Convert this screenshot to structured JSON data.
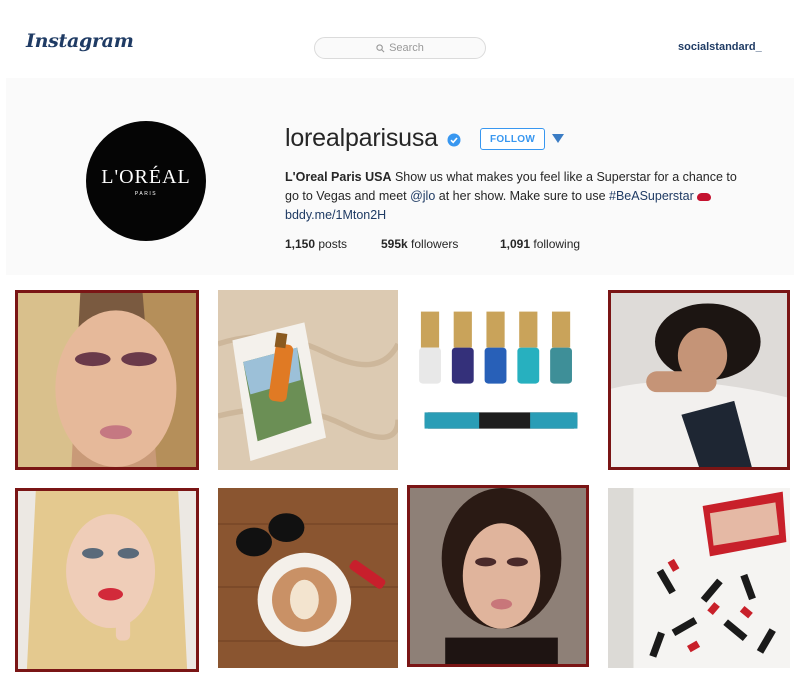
{
  "topbar": {
    "logo": "Instagram",
    "search_placeholder": "Search",
    "current_user": "socialstandard_"
  },
  "profile": {
    "avatar_brand": "L'ORÉAL",
    "avatar_sub": "PARIS",
    "username": "lorealparisusa",
    "follow_label": "FOLLOW",
    "bio_name": "L'Oreal Paris USA",
    "bio_line1": " Show us what makes you feel like a Superstar for a chance to",
    "bio_line2_pre": "go to Vegas and meet ",
    "bio_mention": "@jlo",
    "bio_line2_mid": " at her show. Make sure to use ",
    "bio_hashtag": "#BeASuperstar",
    "bio_link": "bddy.me/1Mton2H",
    "stats": {
      "posts_count": "1,150",
      "posts_label": "posts",
      "followers_count": "595k",
      "followers_label": "followers",
      "following_count": "1,091",
      "following_label": "following"
    }
  },
  "colors": {
    "brand_blue": "#3897f0",
    "link_navy": "#1f3b64",
    "highlight_border": "#7a1515"
  },
  "posts": [
    {
      "subject": "woman with pink eyeshadow closeup",
      "highlighted": true
    },
    {
      "subject": "sunscreen bottle on magazine on sand",
      "highlighted": false
    },
    {
      "subject": "five nail polish bottles and lip liner",
      "highlighted": false
    },
    {
      "subject": "woman under white blanket",
      "highlighted": true
    },
    {
      "subject": "blonde woman with red lipstick",
      "highlighted": true
    },
    {
      "subject": "latte with sunglasses and lipstick on wood",
      "highlighted": false
    },
    {
      "subject": "woman with brown hair and makeup",
      "highlighted": true
    },
    {
      "subject": "red lipstick box and lipsticks on white",
      "highlighted": false
    }
  ]
}
